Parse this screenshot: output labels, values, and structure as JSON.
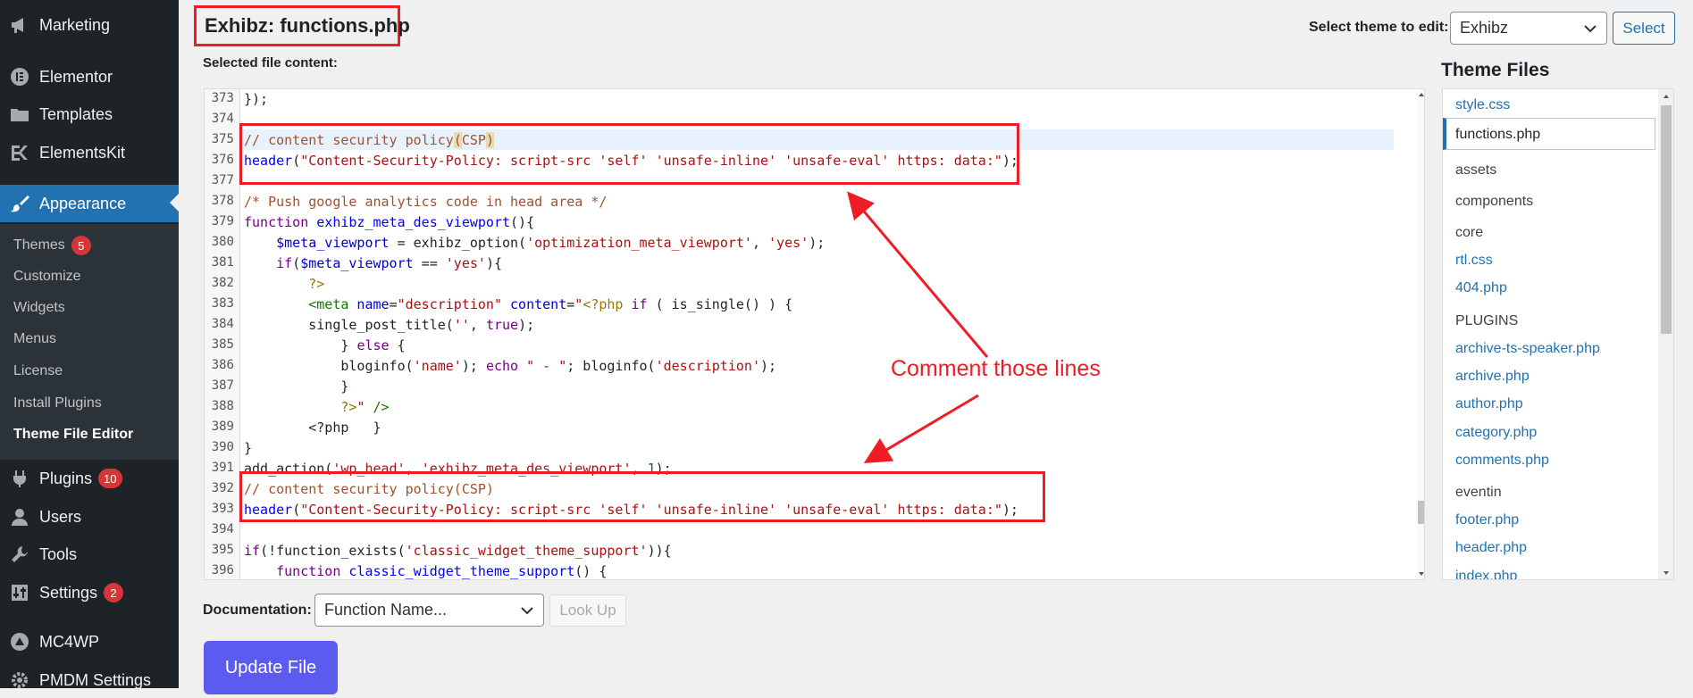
{
  "sidebar": {
    "items": [
      {
        "label": "Marketing",
        "icon": "megaphone-icon"
      },
      {
        "label": "Elementor",
        "icon": "elementor-icon"
      },
      {
        "label": "Templates",
        "icon": "folder-icon"
      },
      {
        "label": "ElementsKit",
        "icon": "elementskit-icon"
      },
      {
        "label": "Appearance",
        "icon": "paintbrush-icon"
      },
      {
        "label": "Plugins",
        "icon": "plug-icon",
        "badge": "10"
      },
      {
        "label": "Users",
        "icon": "user-icon"
      },
      {
        "label": "Tools",
        "icon": "wrench-icon"
      },
      {
        "label": "Settings",
        "icon": "sliders-icon",
        "badge": "2"
      },
      {
        "label": "MC4WP",
        "icon": "mc4wp-icon"
      },
      {
        "label": "PMDM Settings",
        "icon": "gear-icon"
      }
    ],
    "submenu": [
      {
        "label": "Themes",
        "badge": "5"
      },
      {
        "label": "Customize"
      },
      {
        "label": "Widgets"
      },
      {
        "label": "Menus"
      },
      {
        "label": "License"
      },
      {
        "label": "Install Plugins"
      },
      {
        "label": "Theme File Editor"
      }
    ]
  },
  "header": {
    "title": "Exhibz: functions.php",
    "theme_select_label": "Select theme to edit:",
    "theme_select_value": "Exhibz",
    "select_button": "Select"
  },
  "editor": {
    "label": "Selected file content:",
    "lines": [
      {
        "n": "373"
      },
      {
        "n": "374"
      },
      {
        "n": "375"
      },
      {
        "n": "376"
      },
      {
        "n": "377"
      },
      {
        "n": "378"
      },
      {
        "n": "379"
      },
      {
        "n": "380"
      },
      {
        "n": "381"
      },
      {
        "n": "382"
      },
      {
        "n": "383"
      },
      {
        "n": "384"
      },
      {
        "n": "385"
      },
      {
        "n": "386"
      },
      {
        "n": "387"
      },
      {
        "n": "388"
      },
      {
        "n": "389"
      },
      {
        "n": "390"
      },
      {
        "n": "391"
      },
      {
        "n": "392"
      },
      {
        "n": "393"
      },
      {
        "n": "394"
      },
      {
        "n": "395"
      },
      {
        "n": "396"
      }
    ],
    "code": {
      "l373": "});",
      "l375_comment": "// content security policy",
      "l375_paren_open": "(",
      "l375_csp": "CSP",
      "l375_paren_close": ")",
      "l376_fn": "header",
      "l376_str": "\"Content-Security-Policy: script-src 'self' 'unsafe-inline' 'unsafe-eval' https: data:\"",
      "l378_comment": "/* Push google analytics code in head area */",
      "l379_kw": "function",
      "l379_name": "exhibz_meta_des_viewport",
      "l379_rest": "(){",
      "l380_var": "$meta_viewport",
      "l380_mid": " = exhibz_option(",
      "l380_s1": "'optimization_meta_viewport'",
      "l380_comma": ", ",
      "l380_s2": "'yes'",
      "l380_end": ");",
      "l381_kw": "if",
      "l381_open": "(",
      "l381_var": "$meta_viewport",
      "l381_mid": " == ",
      "l381_str": "'yes'",
      "l381_end": "){",
      "l382": "?>",
      "l383_tag": "<meta",
      "l383_a1": " name",
      "l383_eq1": "=",
      "l383_v1": "\"description\"",
      "l383_a2": " content",
      "l383_eq2": "=",
      "l383_v2": "\"",
      "l383_php": "<?php",
      "l383_kw": " if",
      "l383_rest": " ( is_single() ) {",
      "l384_fn": "single_post_title(",
      "l384_str": "''",
      "l384_comma": ", ",
      "l384_kw": "true",
      "l384_end": ");",
      "l385_close": "} ",
      "l385_kw": "else",
      "l385_open": " {",
      "l386_fn": "bloginfo(",
      "l386_s1": "'name'",
      "l386_mid": "); ",
      "l386_kw": "echo",
      "l386_s2": " \" - \"",
      "l386_mid2": "; bloginfo(",
      "l386_s3": "'description'",
      "l386_end": ");",
      "l387": "}",
      "l388_php": "?>",
      "l388_str": "\"",
      "l388_tag": " />",
      "l389": "<?php   }",
      "l390": "}",
      "l391_fn": "add_action(",
      "l391_s1": "'wp_head'",
      "l391_comma": ", ",
      "l391_s2": "'exhibz_meta_des_viewport'",
      "l391_comma2": ", ",
      "l391_num": "1",
      "l391_end": ");",
      "l392_comment": "// content security policy(CSP)",
      "l393_fn": "header",
      "l393_str": "\"Content-Security-Policy: script-src 'self' 'unsafe-inline' 'unsafe-eval' https: data:\"",
      "l395_kw": "if",
      "l395_mid": "(!function_exists(",
      "l395_str": "'classic_widget_theme_support'",
      "l395_end": ")){",
      "l396_kw": "function",
      "l396_name": " classic_widget_theme_support",
      "l396_end": "() {",
      "paren_open": "(",
      "paren_close_semi": ");"
    }
  },
  "theme_files": {
    "title": "Theme Files",
    "items": [
      {
        "label": "style.css",
        "type": "file"
      },
      {
        "label": "functions.php",
        "type": "file",
        "active": true
      },
      {
        "label": "assets",
        "type": "dir"
      },
      {
        "label": "components",
        "type": "dir"
      },
      {
        "label": "core",
        "type": "dir"
      },
      {
        "label": "rtl.css",
        "type": "file"
      },
      {
        "label": "404.php",
        "type": "file"
      },
      {
        "label": "PLUGINS",
        "type": "dir"
      },
      {
        "label": "archive-ts-speaker.php",
        "type": "file"
      },
      {
        "label": "archive.php",
        "type": "file"
      },
      {
        "label": "author.php",
        "type": "file"
      },
      {
        "label": "category.php",
        "type": "file"
      },
      {
        "label": "comments.php",
        "type": "file"
      },
      {
        "label": "eventin",
        "type": "dir"
      },
      {
        "label": "footer.php",
        "type": "file"
      },
      {
        "label": "header.php",
        "type": "file"
      },
      {
        "label": "index.php",
        "type": "file"
      }
    ]
  },
  "documentation": {
    "label": "Documentation:",
    "select_value": "Function Name...",
    "lookup_button": "Look Up"
  },
  "update_button": "Update File",
  "annotation": {
    "note": "Comment those lines",
    "color": "#ee1c25"
  },
  "colors": {
    "sidebar_bg": "#1d2327",
    "active_menu": "#2271b1",
    "badge": "#d63638",
    "update_button": "#5b5bef"
  }
}
